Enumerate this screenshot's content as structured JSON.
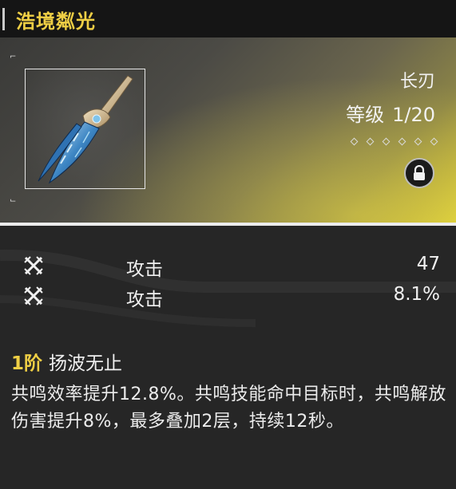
{
  "weapon": {
    "name": "浩境粼光",
    "type": "长刃",
    "level_label": "等级",
    "level_value": "1/20",
    "rank_stars": 6,
    "locked": true
  },
  "stats": [
    {
      "icon": "crossed-swords-icon",
      "name": "攻击",
      "value": "47"
    },
    {
      "icon": "crossed-swords-icon",
      "name": "攻击",
      "value": "8.1%"
    }
  ],
  "passive": {
    "rank": "1阶",
    "name": "扬波无止",
    "description": "共鸣效率提升12.8%。共鸣技能命中目标时，共鸣解放伤害提升8%，最多叠加2层，持续12秒。"
  },
  "colors": {
    "accent": "#efcf45",
    "background": "#262626"
  }
}
